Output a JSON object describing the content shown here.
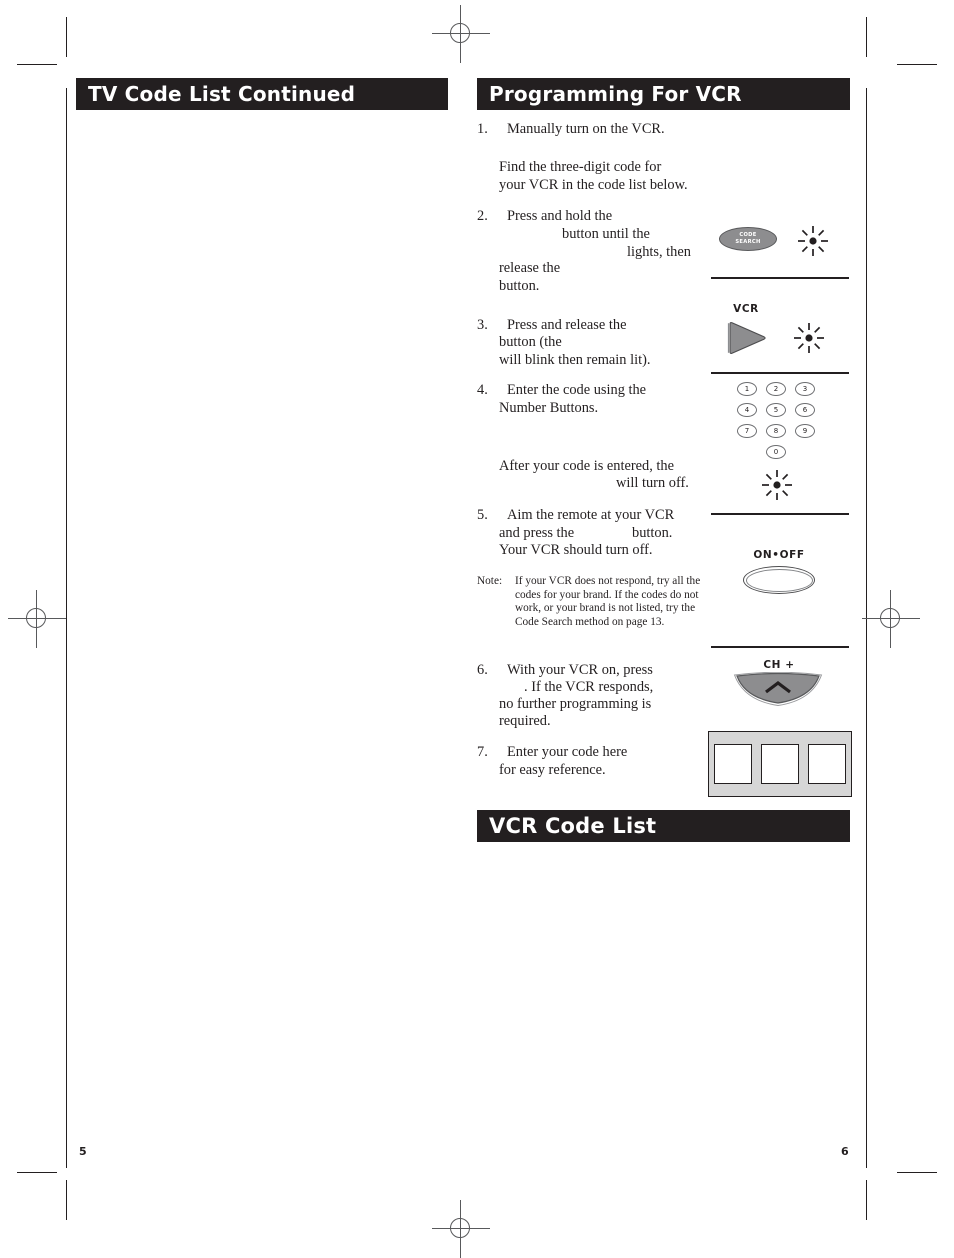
{
  "document": {
    "left_page_number": "5",
    "right_page_number": "6"
  },
  "headers": {
    "left": "TV Code List Continued",
    "right_top": "Programming For VCR",
    "right_bottom": "VCR Code List"
  },
  "steps": [
    {
      "number": "1.",
      "text": "Manually turn on the VCR.",
      "continuation": "Find the three-digit code for\nyour VCR in the code list below."
    },
    {
      "number": "2.",
      "line1": "Press and hold the",
      "line2": "button until the",
      "line3": "lights, then",
      "line4": "release the",
      "line5": "button."
    },
    {
      "number": "3.",
      "line1": "Press and release the",
      "line2": "button (the",
      "line3": "will blink then remain lit)."
    },
    {
      "number": "4.",
      "line1": "Enter the code using the",
      "line2": "Number Buttons.",
      "after1": "After your code is entered, the",
      "after2": "will turn off."
    },
    {
      "number": "5.",
      "line1": "Aim the remote at your VCR",
      "line2": "and press the",
      "line2b": "button.",
      "line3": "Your VCR should turn off."
    },
    {
      "number": "6.",
      "line1": "With your VCR on, press",
      "line2": ". If the VCR responds,",
      "line3": "no further programming is",
      "line4": "required."
    },
    {
      "number": "7.",
      "line1": "Enter your code here",
      "line2": "for easy reference."
    }
  ],
  "note": {
    "label": "Note:",
    "text": "If your VCR does not respond, try all the codes for your brand. If the codes do not work, or your brand is not listed, try the Code Search method on page 13."
  },
  "graphics": {
    "code_search_label_line1": "CODE",
    "code_search_label_line2": "SEARCH",
    "vcr_label": "VCR",
    "onoff_label": "ON•OFF",
    "ch_label": "CH +",
    "keypad": [
      "1",
      "2",
      "3",
      "4",
      "5",
      "6",
      "7",
      "8",
      "9",
      "0"
    ]
  },
  "colors": {
    "header_bar": "#231f20",
    "header_text": "#ffffff",
    "button_gray": "#8d8d8f",
    "panel_gray": "#d6d6d6",
    "rule": "#231f20",
    "body_text": "#231f20"
  }
}
